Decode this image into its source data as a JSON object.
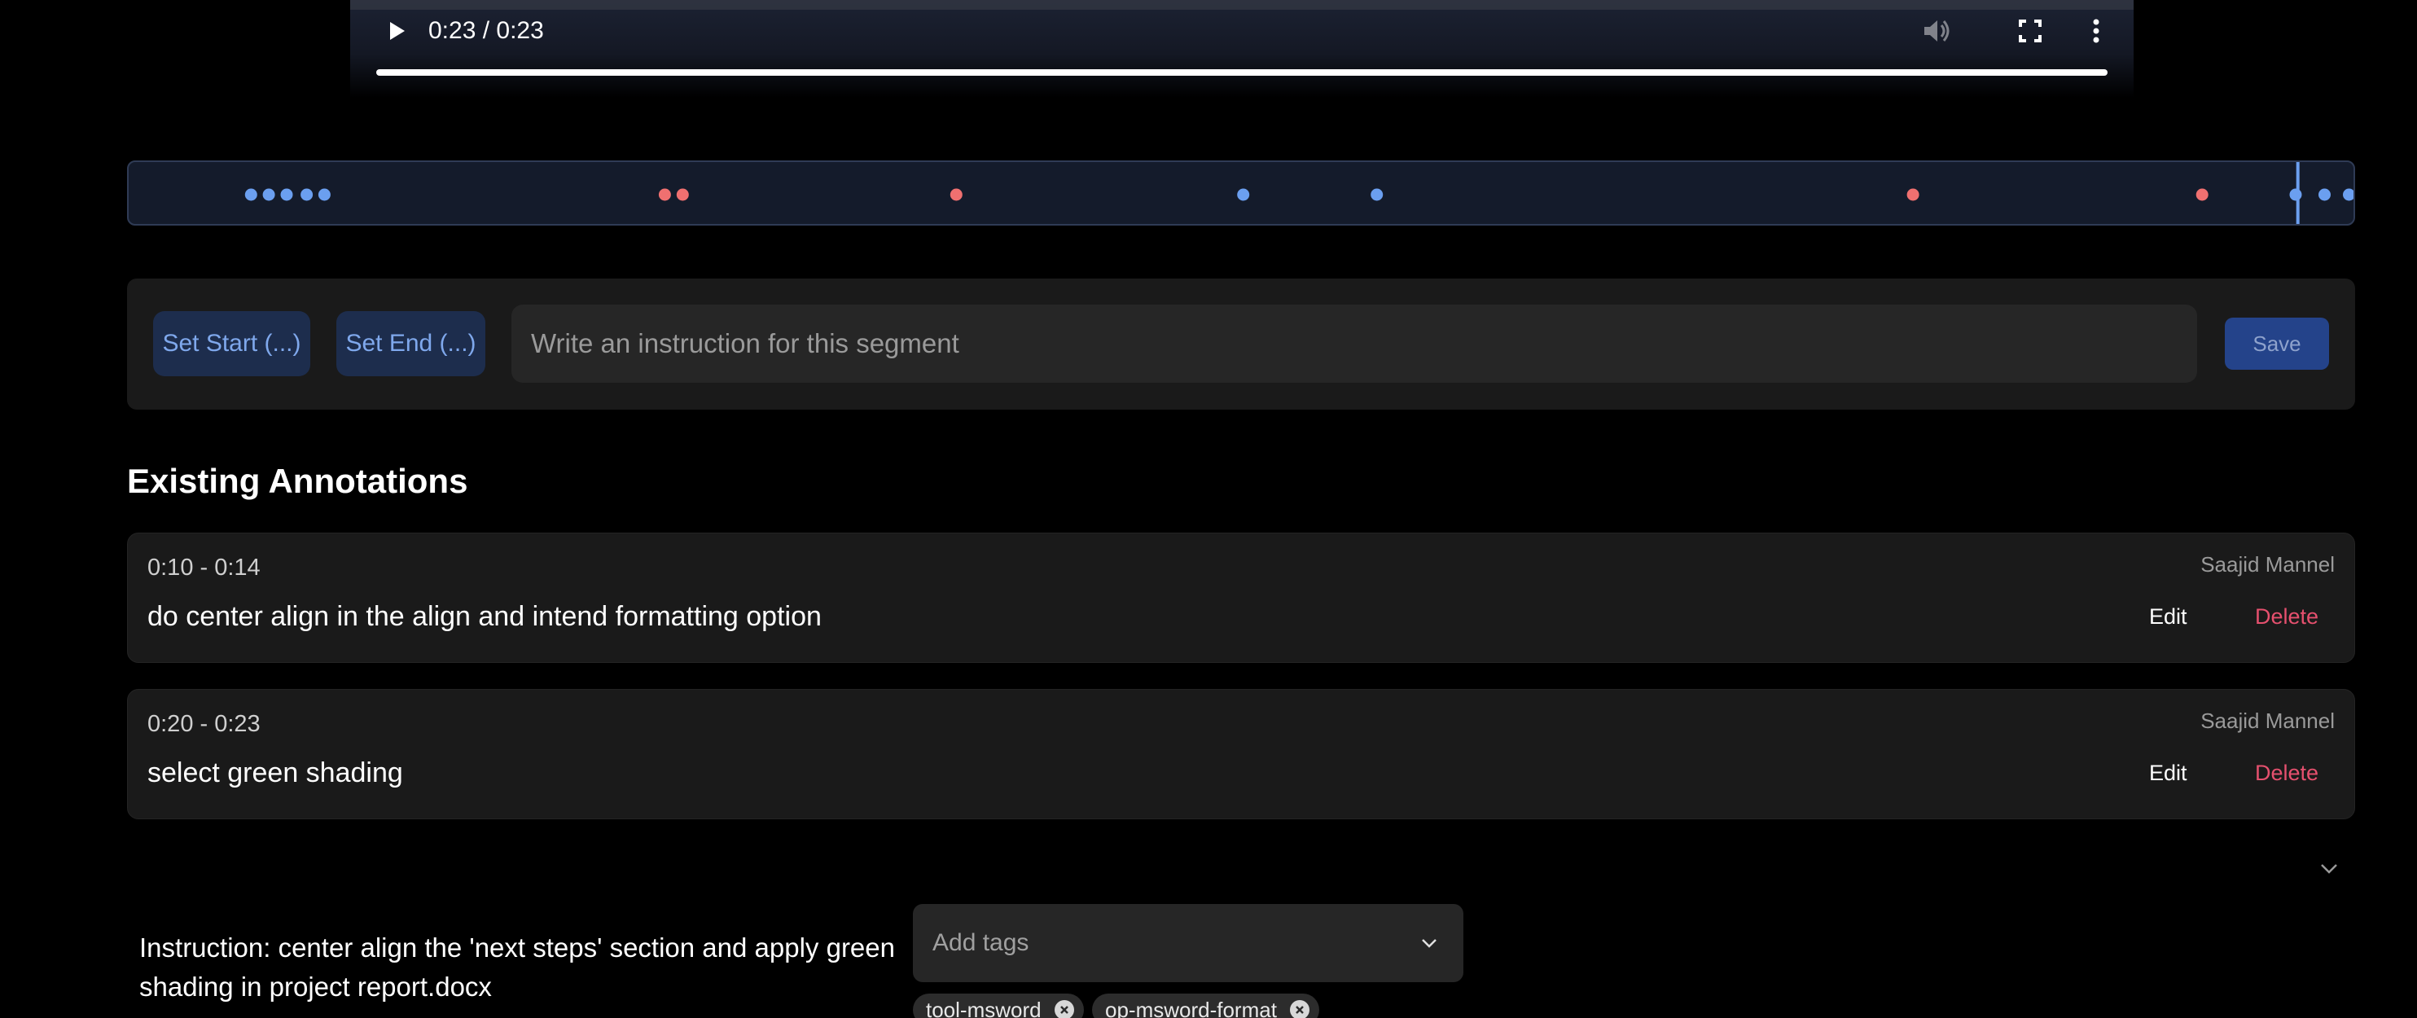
{
  "player": {
    "time": "0:23 / 0:23",
    "progress_fraction": 1.0,
    "icons": [
      "play-icon",
      "volume-icon",
      "fullscreen-icon",
      "more-vert-icon"
    ]
  },
  "timeline": {
    "markers": [
      {
        "position": 0.055,
        "color": "#6b9ff0"
      },
      {
        "position": 0.063,
        "color": "#6b9ff0"
      },
      {
        "position": 0.071,
        "color": "#6b9ff0"
      },
      {
        "position": 0.08,
        "color": "#6b9ff0"
      },
      {
        "position": 0.088,
        "color": "#6b9ff0"
      },
      {
        "position": 0.241,
        "color": "#f07070"
      },
      {
        "position": 0.249,
        "color": "#f07070"
      },
      {
        "position": 0.372,
        "color": "#f07070"
      },
      {
        "position": 0.501,
        "color": "#6b9ff0"
      },
      {
        "position": 0.561,
        "color": "#6b9ff0"
      },
      {
        "position": 0.802,
        "color": "#f07070"
      },
      {
        "position": 0.932,
        "color": "#f07070"
      },
      {
        "position": 0.974,
        "color": "#6b9ff0"
      },
      {
        "position": 0.987,
        "color": "#6b9ff0"
      },
      {
        "position": 0.998,
        "color": "#6b9ff0"
      }
    ],
    "playhead": 0.975
  },
  "editor": {
    "set_start_label": "Set Start (...)",
    "set_end_label": "Set End (...)",
    "instruction_placeholder": "Write an instruction for this segment",
    "save_label": "Save"
  },
  "annotations_title": "Existing Annotations",
  "annotations": [
    {
      "range": "0:10 - 0:14",
      "author": "Saajid Mannel",
      "text": "do center align in the align and intend formatting option",
      "edit_label": "Edit",
      "delete_label": "Delete"
    },
    {
      "range": "0:20 - 0:23",
      "author": "Saajid Mannel",
      "text": "select green shading",
      "edit_label": "Edit",
      "delete_label": "Delete"
    }
  ],
  "task": {
    "instruction": "Instruction: center align the 'next steps' section and apply green shading in project report.docx",
    "tags_placeholder": "Add tags",
    "tags": [
      "tool-msword",
      "op-msword-format"
    ]
  },
  "colors": {
    "accent_blue": "#6b9ff0",
    "marker_red": "#f07070",
    "delete_red": "#e5506e",
    "save_bg": "#24438a"
  }
}
